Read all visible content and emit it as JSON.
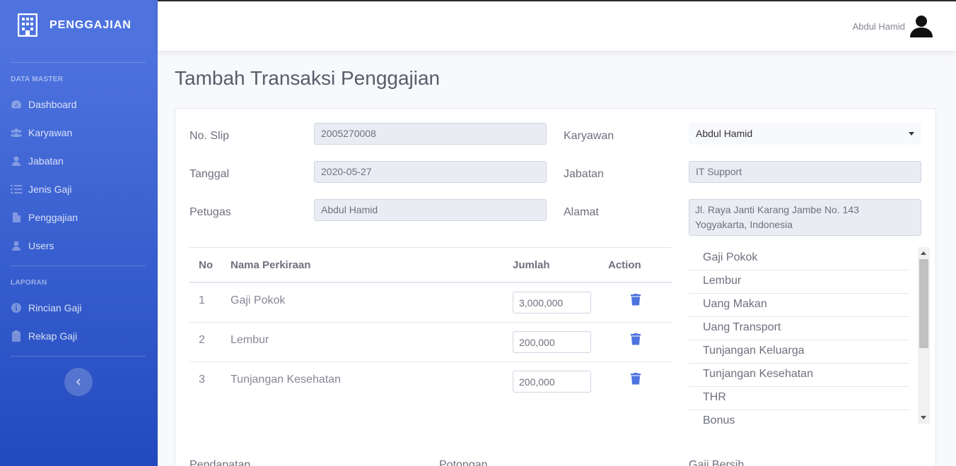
{
  "sidebar": {
    "brand": "PENGGAJIAN",
    "heading_master": "DATA MASTER",
    "heading_laporan": "LAPORAN",
    "items": [
      {
        "label": "Dashboard",
        "icon": "tachometer-icon"
      },
      {
        "label": "Karyawan",
        "icon": "users-icon"
      },
      {
        "label": "Jabatan",
        "icon": "user-icon"
      },
      {
        "label": "Jenis Gaji",
        "icon": "list-icon"
      },
      {
        "label": "Penggajian",
        "icon": "file-icon"
      },
      {
        "label": "Users",
        "icon": "user-icon"
      }
    ],
    "report_items": [
      {
        "label": "Rincian Gaji",
        "icon": "info-circle-icon"
      },
      {
        "label": "Rekap Gaji",
        "icon": "clipboard-icon"
      }
    ]
  },
  "topbar": {
    "user_name": "Abdul Hamid"
  },
  "page": {
    "title": "Tambah Transaksi Penggajian"
  },
  "form": {
    "no_slip_label": "No. Slip",
    "no_slip": "2005270008",
    "tanggal_label": "Tanggal",
    "tanggal": "2020-05-27",
    "petugas_label": "Petugas",
    "petugas": "Abdul Hamid",
    "karyawan_label": "Karyawan",
    "karyawan": "Abdul Hamid",
    "jabatan_label": "Jabatan",
    "jabatan": "IT Support",
    "alamat_label": "Alamat",
    "alamat": "Jl. Raya Janti Karang Jambe No. 143  Yogyakarta, Indonesia"
  },
  "table": {
    "headers": {
      "no": "No",
      "nama": "Nama Perkiraan",
      "jumlah": "Jumlah",
      "action": "Action"
    },
    "rows": [
      {
        "no": "1",
        "nama": "Gaji Pokok",
        "jumlah": "3,000,000"
      },
      {
        "no": "2",
        "nama": "Lembur",
        "jumlah": "200,000"
      },
      {
        "no": "3",
        "nama": "Tunjangan Kesehatan",
        "jumlah": "200,000"
      }
    ]
  },
  "gaji_list": [
    "Gaji Pokok",
    "Lembur",
    "Uang Makan",
    "Uang Transport",
    "Tunjangan Keluarga",
    "Tunjangan Kesehatan",
    "THR",
    "Bonus"
  ],
  "bottom": {
    "left": "Pendapatan",
    "mid": "Potongan",
    "right": "Gaji Bersih"
  },
  "colors": {
    "primary": "#4e73df",
    "sidebar_end": "#224abe"
  }
}
